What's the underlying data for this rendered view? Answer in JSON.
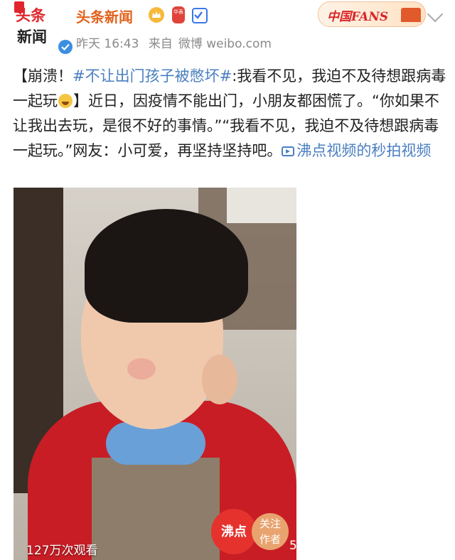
{
  "header": {
    "avatar": {
      "top_text": "头条",
      "bottom_text": "新闻"
    },
    "username": "头条新闻",
    "badges": [
      "crown-icon",
      "pill-icon",
      "check-icon"
    ],
    "pill_text": "华表",
    "time": "昨天 16:43",
    "source_prefix": "来自",
    "source": "微博 weibo.com",
    "fans_badge": "中国FANS"
  },
  "post": {
    "bracket_open": "【崩溃！",
    "hashtag": "#不让出门孩子被憋坏#",
    "text_1": ":我看不见，我迫不及待想跟病毒一起玩",
    "emoji": "laughing-emoji",
    "text_2": "】近日，因疫情不能出门，小朋友都困慌了。“你如果不让我出去玩，是很不好的事情。”“我看不见，我迫不及待想跟病毒一起玩。”网友：小可爱，再坚持坚持吧。",
    "video_link": "沸点视频的秒拍视频"
  },
  "video": {
    "views": "127万次观看",
    "brand": "沸点",
    "follow_line1": "关注",
    "follow_line2": "作者",
    "trailing_digit": "5"
  },
  "colors": {
    "username": "#e2621b",
    "link": "#4a7fc1",
    "meta": "#8a8a8a",
    "brand": "#e5322d"
  }
}
